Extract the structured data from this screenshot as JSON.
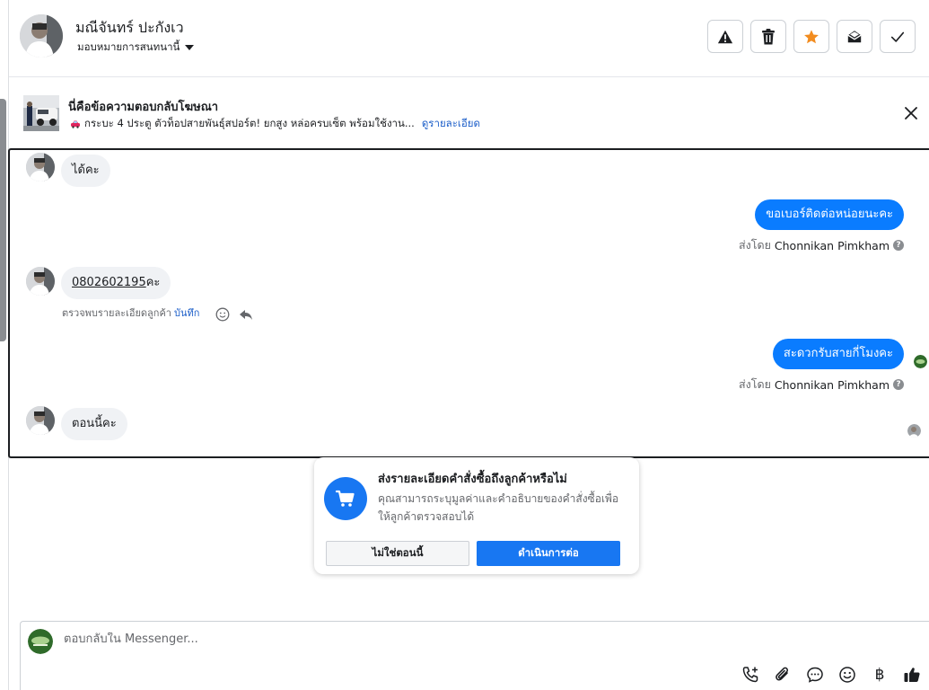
{
  "header": {
    "customer_name": "มณีจันทร์ ปะกังเว",
    "assign_label": "มอบหมายการสนทนานี้",
    "actions": [
      "warning-icon",
      "trash-icon",
      "star-icon",
      "mail-open-icon",
      "check-icon"
    ],
    "star_color": "#f28c1f"
  },
  "ad_banner": {
    "title": "นี่คือข้อความตอบกลับโฆษณา",
    "subtitle": "กระบะ 4 ประตู ตัวท็อปสายพันธุ์สปอร์ต! ยกสูง หล่อครบเซ็ต พร้อมใช้งาน...",
    "link": "ดูรายละเอียด"
  },
  "messages": {
    "m1": "ได้คะ",
    "m2": "ขอเบอร์ติดต่อหน่อยนะคะ",
    "m2_sent_prefix": "ส่งโดย",
    "m2_sender": "Chonnikan Pimkham",
    "m3_phone": "0802602195",
    "m3_suffix": "คะ",
    "detected_text": "ตรวจพบรายละเอียดลูกค้า",
    "detected_save": "บันทึก",
    "m4": "สะดวกรับสายกี่โมงคะ",
    "m4_sent_prefix": "ส่งโดย",
    "m4_sender": "Chonnikan Pimkham",
    "m5": "ตอนนี้คะ",
    "help_mark": "?"
  },
  "order_prompt": {
    "title": "ส่งรายละเอียดคำสั่งซื้อถึงลูกค้าหรือไม่",
    "description": "คุณสามารถระบุมูลค่าและคำอธิบายของคำสั่งซื้อเพื่อให้ลูกค้าตรวจสอบได้",
    "later_button": "ไม่ใช่ตอนนี้",
    "continue_button": "ดำเนินการต่อ"
  },
  "composer": {
    "placeholder": "ตอบกลับใน Messenger...",
    "tools": [
      "call-add-icon",
      "paperclip-icon",
      "chat-bubble-icon",
      "emoji-icon",
      "baht-icon",
      "thumbs-up-icon"
    ],
    "baht_symbol": "฿"
  },
  "colors": {
    "accent_blue": "#0a7cff",
    "link_blue": "#1d5fc9",
    "button_blue": "#1877f2"
  }
}
